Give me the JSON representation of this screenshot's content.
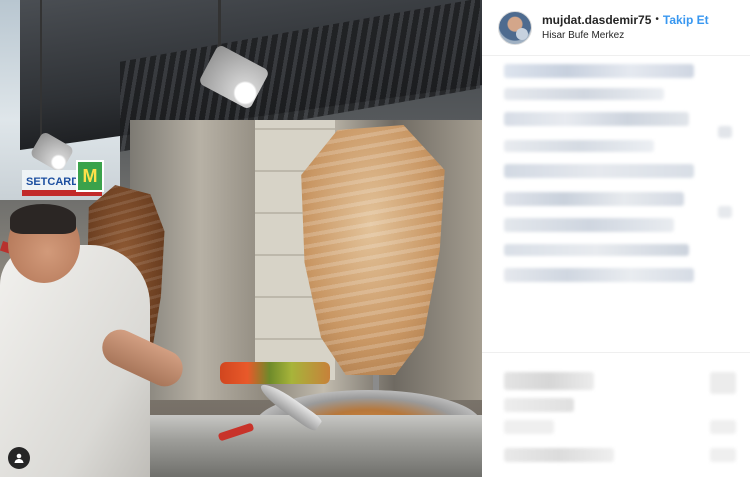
{
  "post": {
    "username": "mujdat.dasdemir75",
    "separator": "•",
    "follow_label": "Takip Et",
    "location": "Hisar Bufe Merkez"
  },
  "photo": {
    "sign_text": "SETCARD",
    "sign_badge": "M"
  },
  "colors": {
    "follow": "#3897f0",
    "text": "#262626",
    "border": "#efefef"
  },
  "icons": {
    "user_tag": "person-icon",
    "avatar": "profile-avatar"
  }
}
